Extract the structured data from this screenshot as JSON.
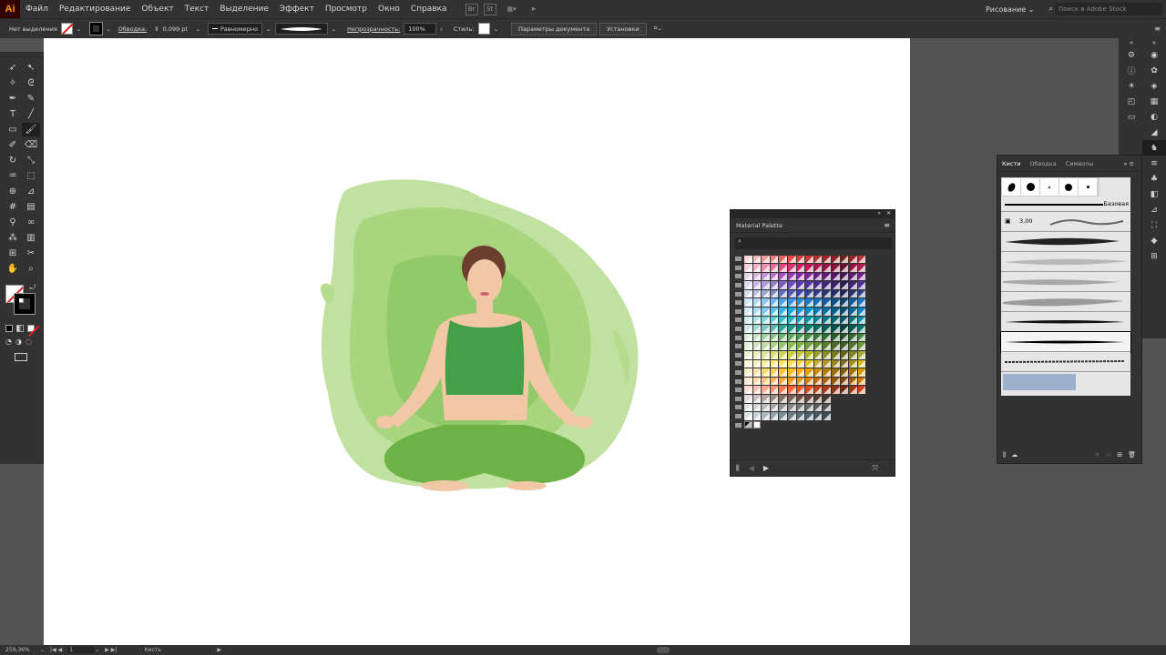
{
  "app": {
    "logo": "Ai",
    "workspace": "Рисование",
    "search_placeholder": "Поиск в Adobe Stock"
  },
  "menu": [
    "Файл",
    "Редактирование",
    "Объект",
    "Текст",
    "Выделение",
    "Эффект",
    "Просмотр",
    "Окно",
    "Справка"
  ],
  "menu_icons": {
    "bridge": "Br",
    "stock": "St"
  },
  "control_bar": {
    "selection": "Нет выделения",
    "stroke_label": "Обводка:",
    "stroke_value": "0,099 pt",
    "stroke_profile": "Равномерно",
    "opacity_label": "Непрозрачность:",
    "opacity_value": "100%",
    "style_label": "Стиль:",
    "doc_settings": "Параметры документа",
    "preferences": "Установки"
  },
  "material_palette": {
    "title": "Material Palette",
    "colors": [
      "#e53935",
      "#d81b60",
      "#8e24aa",
      "#5e35b1",
      "#3949ab",
      "#1e88e5",
      "#039be5",
      "#00acc1",
      "#00897b",
      "#43a047",
      "#7cb342",
      "#c0ca33",
      "#fdd835",
      "#ffb300",
      "#fb8c00",
      "#f4511e",
      "#6d4c41",
      "#757575",
      "#546e7a"
    ]
  },
  "brushes_panel": {
    "tabs": [
      "Кисти",
      "Обводка",
      "Символы"
    ],
    "basic_label": "Базовая",
    "size_value": "3,00"
  },
  "status": {
    "zoom": "259,36%",
    "artboard": "1",
    "tool": "Кисть"
  },
  "accent": "#ff9a00"
}
